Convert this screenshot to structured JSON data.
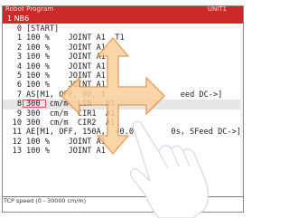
{
  "window": {
    "title": "Robot Program",
    "title_right": "UNIT1",
    "program_name": "1 NB6"
  },
  "lines": [
    {
      "num": "0",
      "text": "[START]"
    },
    {
      "num": "1",
      "text": "100 %    JOINT A1  T1"
    },
    {
      "num": "2",
      "text": "100 %    JOINT A1"
    },
    {
      "num": "3",
      "text": "100 %    JOINT A1"
    },
    {
      "num": "4",
      "text": "100 %    JOINT A1"
    },
    {
      "num": "5",
      "text": "100 %    JOINT A1"
    },
    {
      "num": "6",
      "text": "100 %    JOINT A1"
    },
    {
      "num": "7",
      "text": "AS[M1, OFF, 00, 1                eed DC->]"
    },
    {
      "num": "8",
      "text": "300  cm/m  LIN   A1"
    },
    {
      "num": "9",
      "text": "300  cm/m  CIR1  A1"
    },
    {
      "num": "10",
      "text": "300  cm/m  CIR2  A1"
    },
    {
      "num": "11",
      "text": "AE[M1, OFF, 150A,  +0.0        0s, SFeed DC->]"
    },
    {
      "num": "12",
      "text": "100 %    JOINT A1"
    },
    {
      "num": "13",
      "text": "100 %    JOINT A1"
    }
  ],
  "selected_line": 8,
  "status": {
    "hint": "TCP speed (0 - 30000 cm/m)"
  },
  "colors": {
    "titlebar": "#cc2a2a",
    "selection_box": "#e24b4b",
    "arrow_fill": "#fbcf9b",
    "arrow_stroke": "#e59a55"
  },
  "icons": {
    "gesture_arrows": "four-way-arrow-icon",
    "hand": "pointing-hand-icon"
  }
}
